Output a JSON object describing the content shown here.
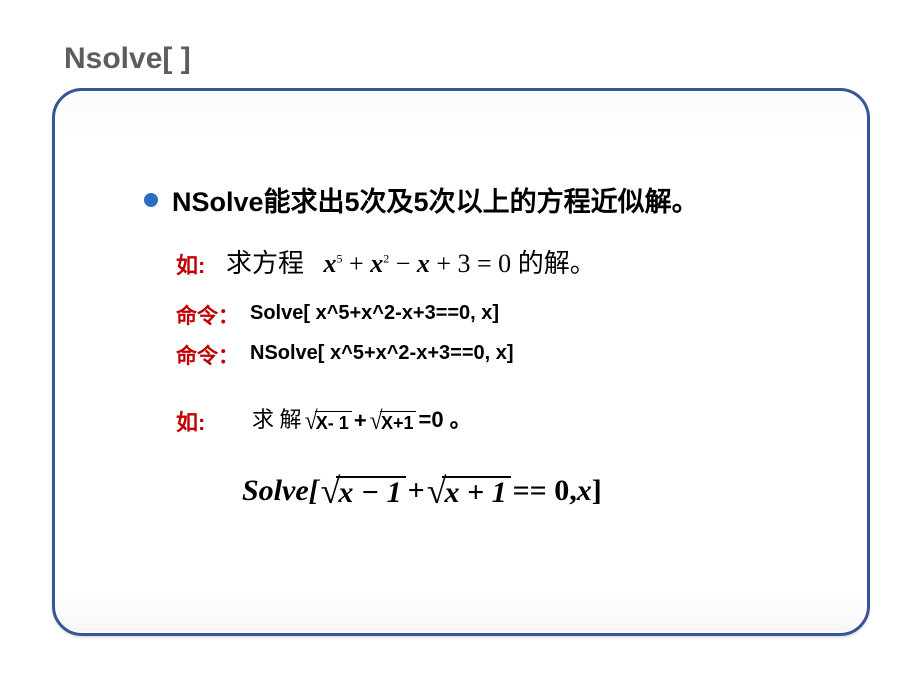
{
  "title": "Nsolve[ ]",
  "bullet": {
    "lead": "N",
    "text": "Solve能求出5次及5次以上的方程近似解。"
  },
  "example1": {
    "label": "如:",
    "prefix": "求方程",
    "eq_var": "x",
    "eq_p1": "5",
    "eq_plus1": " + ",
    "eq_var2": "x",
    "eq_p2": "2",
    "eq_plus2": " − ",
    "eq_var3": "x",
    "eq_plus3": " + 3 = 0",
    "suffix": "的解。"
  },
  "cmd1": {
    "label": "命令：",
    "code": "Solve[ x^5+x^2-x+3==0, x]"
  },
  "cmd2": {
    "label": "命令：",
    "code": "NSolve[ x^5+x^2-x+3==0, x]"
  },
  "example2": {
    "label": "如:",
    "prefix": "求 解",
    "rad1": "X- 1",
    "plus": "+",
    "rad2": "X+1",
    "tail": "=0 。"
  },
  "big": {
    "solve_open": "Solve[",
    "rad1": "x − 1",
    "plus": " + ",
    "rad2": "x + 1",
    "eq": " == 0, ",
    "xvar": "x",
    "close": "]"
  }
}
